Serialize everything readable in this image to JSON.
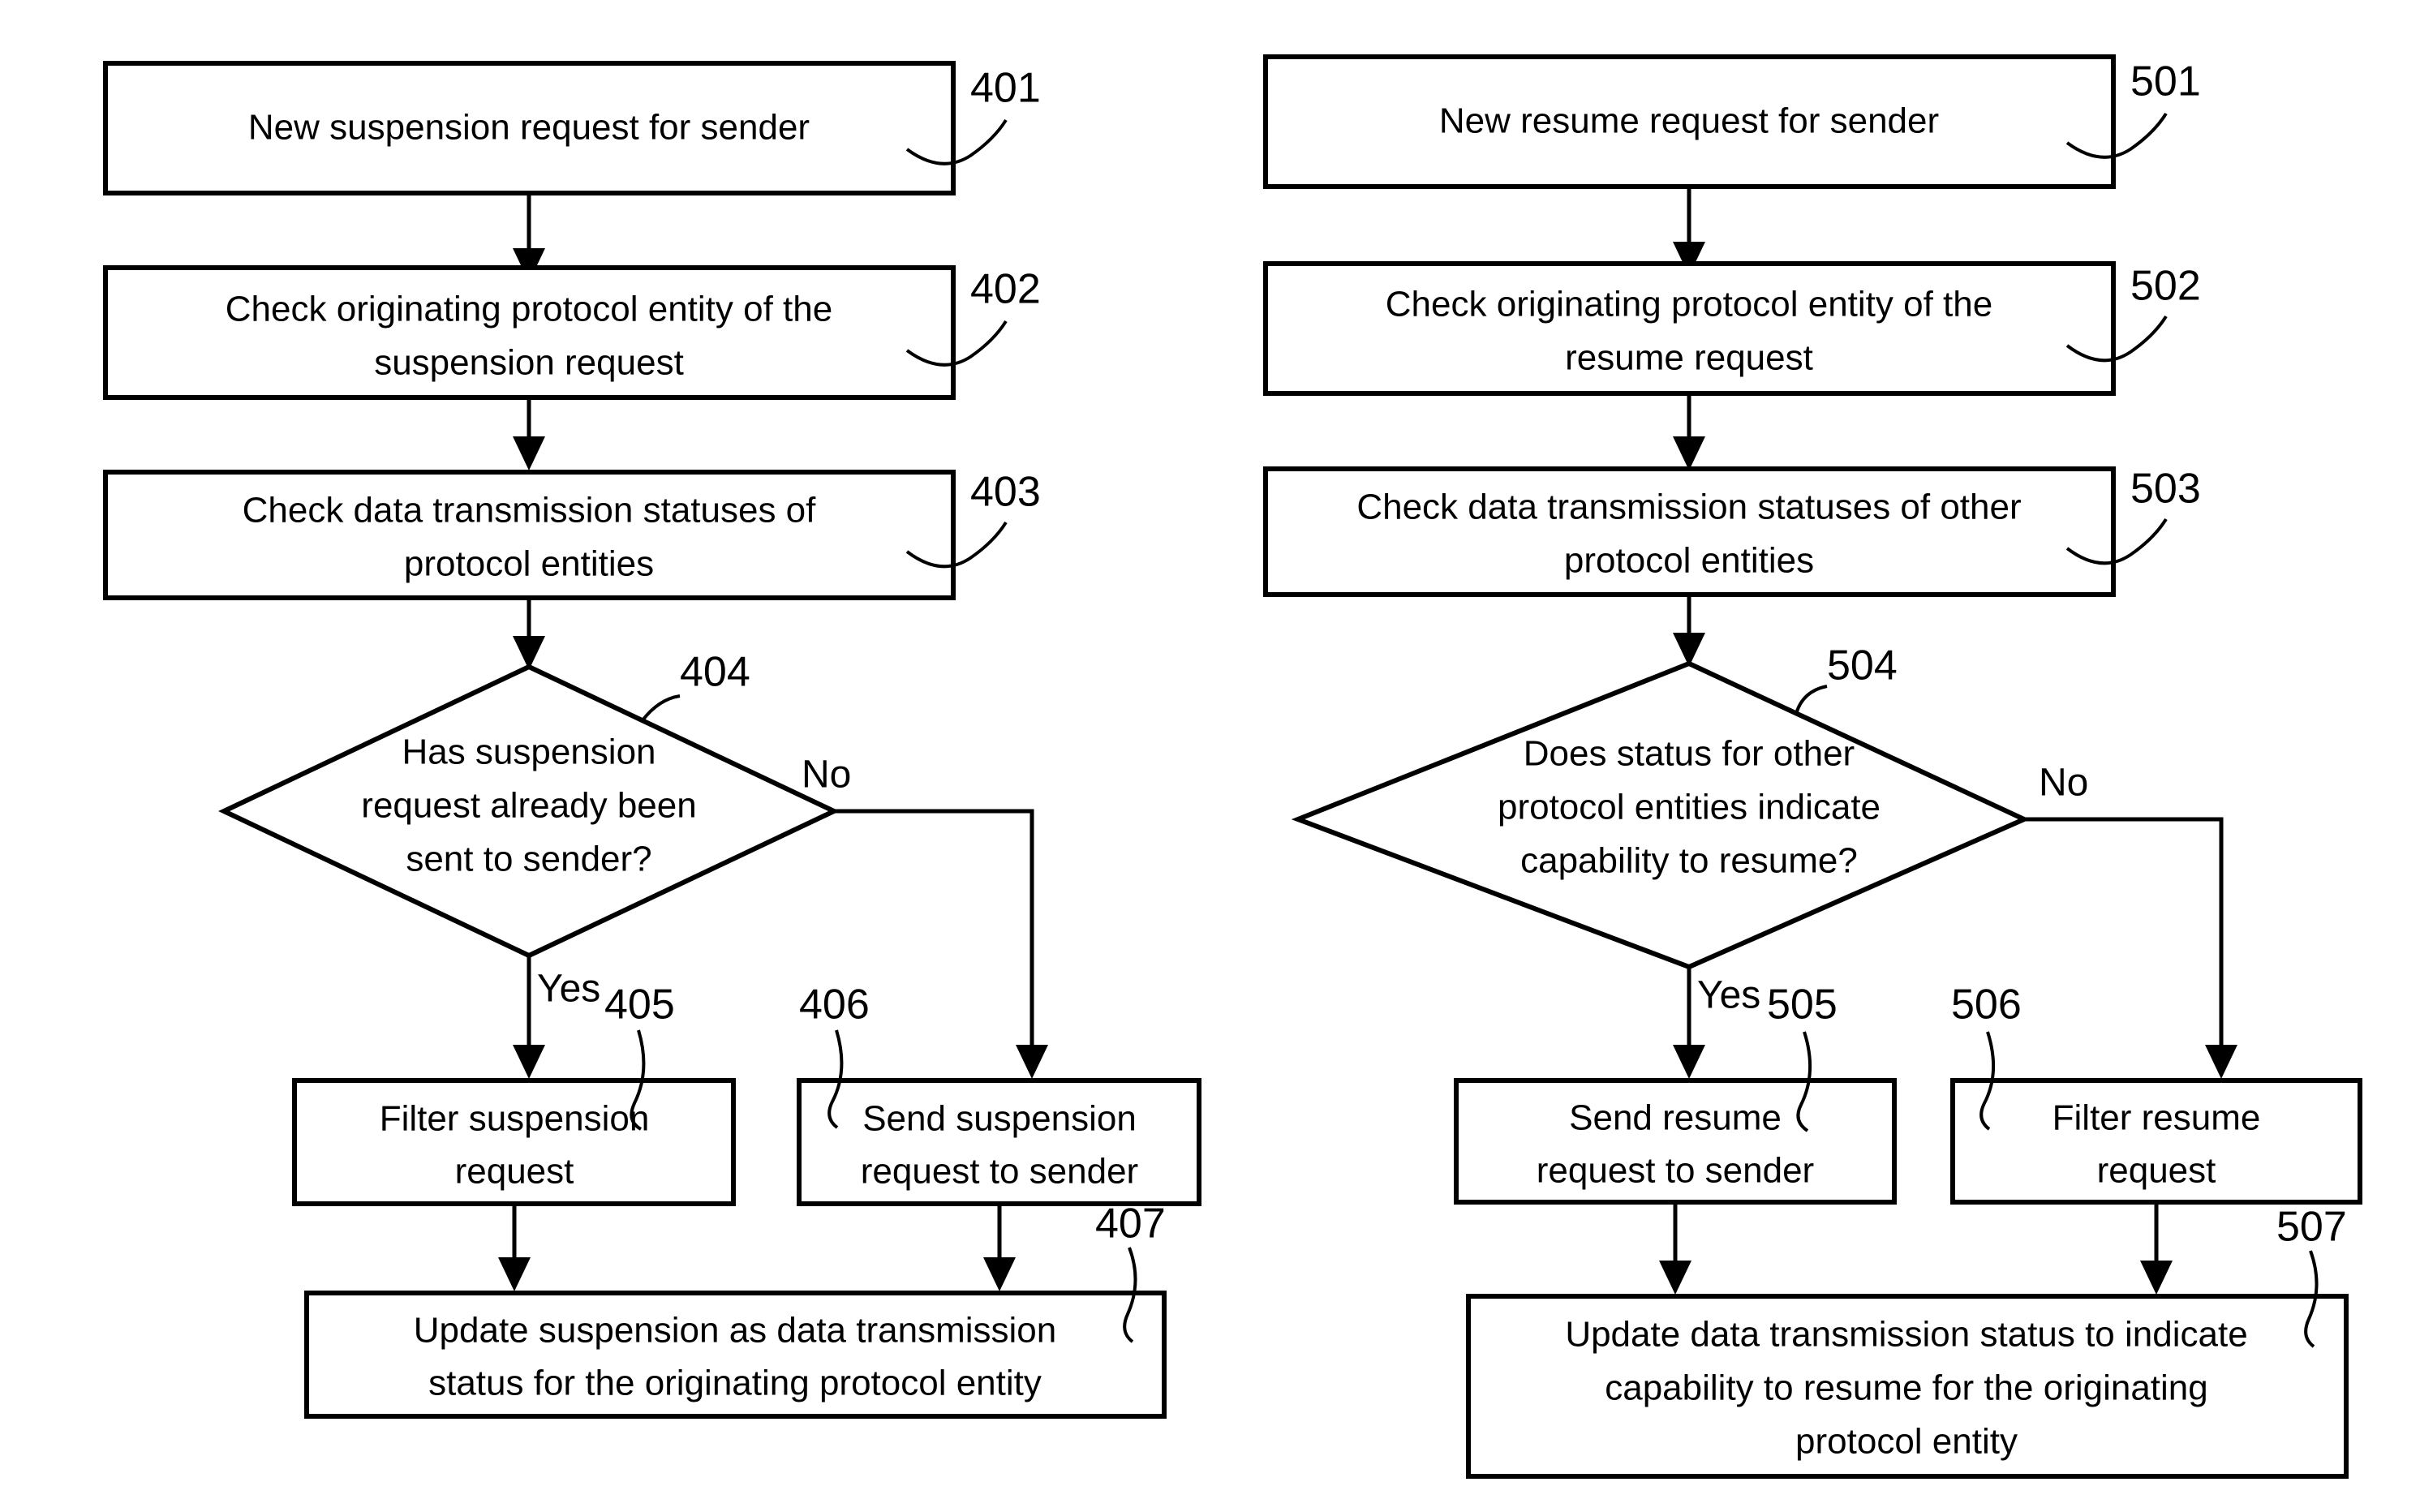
{
  "figure": {
    "background_color": "#ffffff",
    "stroke_color": "#000000",
    "title": "Suspension and resume request handling flowcharts"
  },
  "left_flow": {
    "name": "suspension-request-flow",
    "nodes": [
      {
        "ref": "401",
        "shape": "rect",
        "lines": [
          "New suspension request for sender"
        ]
      },
      {
        "ref": "402",
        "shape": "rect",
        "lines": [
          "Check originating protocol entity of the",
          "suspension request"
        ]
      },
      {
        "ref": "403",
        "shape": "rect",
        "lines": [
          "Check data transmission statuses of",
          "protocol entities"
        ]
      },
      {
        "ref": "404",
        "shape": "diamond",
        "lines": [
          "Has suspension",
          "request already been",
          "sent to sender?"
        ]
      },
      {
        "ref": "405",
        "shape": "rect",
        "lines": [
          "Filter suspension",
          "request"
        ]
      },
      {
        "ref": "406",
        "shape": "rect",
        "lines": [
          "Send suspension",
          "request to sender"
        ]
      },
      {
        "ref": "407",
        "shape": "rect",
        "lines": [
          "Update suspension as data transmission",
          "status for the originating protocol entity"
        ]
      }
    ],
    "branch_labels": {
      "yes": "Yes",
      "no": "No"
    }
  },
  "right_flow": {
    "name": "resume-request-flow",
    "nodes": [
      {
        "ref": "501",
        "shape": "rect",
        "lines": [
          "New resume request for sender"
        ]
      },
      {
        "ref": "502",
        "shape": "rect",
        "lines": [
          "Check originating protocol entity of the",
          "resume request"
        ]
      },
      {
        "ref": "503",
        "shape": "rect",
        "lines": [
          "Check data transmission statuses of other",
          "protocol entities"
        ]
      },
      {
        "ref": "504",
        "shape": "diamond",
        "lines": [
          "Does status for other",
          "protocol entities indicate",
          "capability to resume?"
        ]
      },
      {
        "ref": "505",
        "shape": "rect",
        "lines": [
          "Send resume",
          "request to sender"
        ]
      },
      {
        "ref": "506",
        "shape": "rect",
        "lines": [
          "Filter resume",
          "request"
        ]
      },
      {
        "ref": "507",
        "shape": "rect",
        "lines": [
          "Update data transmission status to indicate",
          "capability to resume for the originating",
          "protocol entity"
        ]
      }
    ],
    "branch_labels": {
      "yes": "Yes",
      "no": "No"
    }
  }
}
